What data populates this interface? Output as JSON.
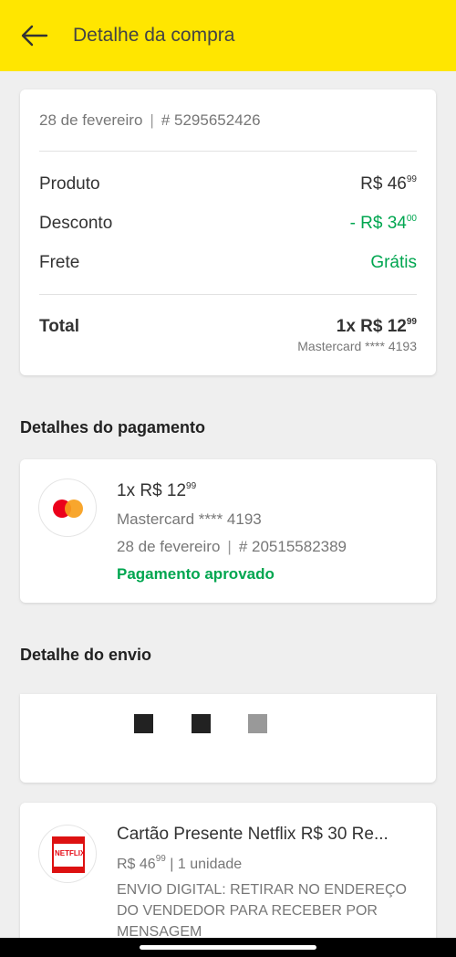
{
  "appbar": {
    "title": "Detalhe da compra"
  },
  "summary": {
    "date": "28 de fevereiro",
    "separator": "|",
    "order_number": "# 5295652426",
    "rows": [
      {
        "label": "Produto",
        "value": "R$ 46",
        "cents": "99"
      },
      {
        "label": "Desconto",
        "value": "- R$ 34",
        "cents": "00"
      },
      {
        "label": "Frete",
        "value": "Grátis"
      }
    ],
    "total": {
      "label": "Total",
      "value": "1x R$ 12",
      "cents": "99",
      "card": "Mastercard **** 4193"
    }
  },
  "payment": {
    "section_title": "Detalhes do pagamento",
    "brand_icon": "mastercard-icon",
    "amount": "1x R$ 12",
    "amount_cents": "99",
    "card": "Mastercard **** 4193",
    "date": "28 de fevereiro",
    "separator": "|",
    "transaction": "# 20515582389",
    "status": "Pagamento aprovado"
  },
  "shipping": {
    "section_title": "Detalhe do envio",
    "progress_dots": [
      "#222222",
      "#222222",
      "#999999"
    ]
  },
  "product": {
    "thumbnail_text": "NETFLIX",
    "title": "Cartão Presente Netflix R$ 30 Re...",
    "price": "R$ 46",
    "price_cents": "99",
    "quantity": "| 1 unidade",
    "description": "ENVIO DIGITAL: RETIRAR NO ENDEREÇO DO VENDEDOR PARA RECEBER POR MENSAGEM"
  },
  "colors": {
    "appbar": "#ffe600",
    "green": "#00a650",
    "mastercard_red": "#eb001b",
    "mastercard_orange": "#f79e1b"
  }
}
